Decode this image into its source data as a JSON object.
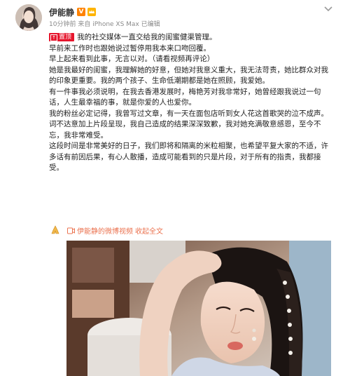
{
  "post": {
    "author": "伊能静",
    "timestamp": "10分钟前",
    "source": "来自 iPhone XS Max",
    "edited": "已编辑",
    "pinned_label": "置顶",
    "paragraphs": [
      "我的社交媒体一直交给我的闺蜜健渠管理。",
      "早前来工作时也跟她说过暂停用我本来口吻回覆。",
      "早上起来看到此事，无言以对。（请看视频再评论）",
      "她是我最好的闺蜜，我理解她的好意，但她对我意义重大，我无法苛责，她比群众对我的印象更重要。我的两个孩子、生命低潮期都是她在照顾，我爱她。",
      "有一件事我必须说明，在我去香港发展时，梅艳芳对我非常好，她曾经跟我说过一句话，人生最幸福的事，就是你爱的人也爱你。",
      "我的粉丝必定记得，我曾写过文章，有一天在面包店听到女人花这首歌哭的泣不成声。",
      "词不达意加上片段呈现，我自己造成的结果深深致歉，我对她充满敬意感恩，至今不忘，我非常难受。",
      "这段时间是非常美好的日子，我们即将和隔离的米粒相聚，也希望平复大家的不适，许多话有前因后果，有心人散播，造成可能看到的只是片段，对于所有的指责，我都接受。"
    ],
    "video_link_label": "伊能静的微博视频",
    "expand_label": "收起全文"
  },
  "colors": {
    "link": "#eb7350",
    "pin_bg": "#e6162d",
    "vip": "#ff8200"
  },
  "icons": {
    "avatar": "avatar",
    "vip": "vip-badge-icon",
    "crown": "crown-icon",
    "chevron": "chevron-down-icon",
    "hands": "praying-hands-icon",
    "video": "video-icon"
  }
}
